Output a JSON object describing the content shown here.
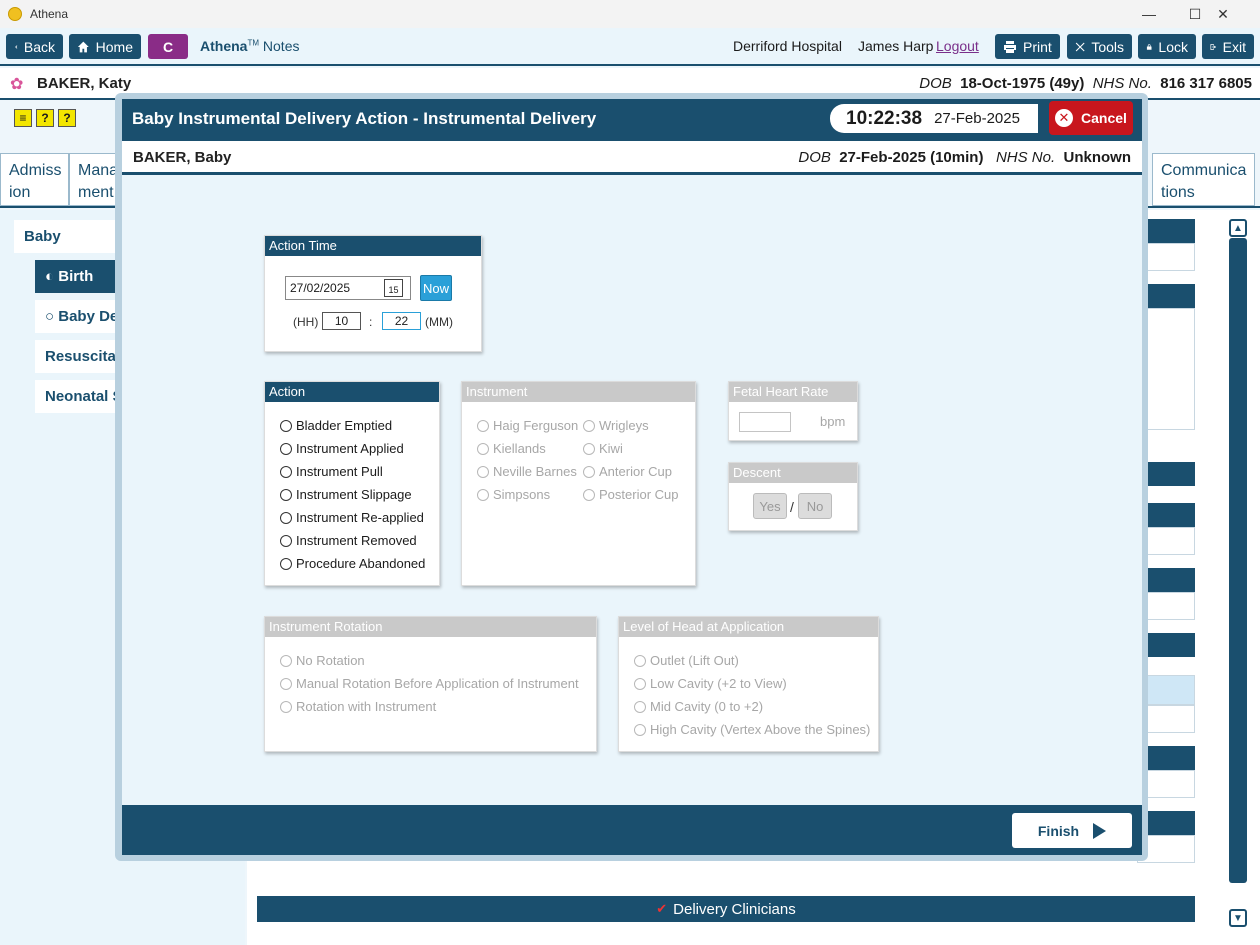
{
  "window": {
    "title": "Athena",
    "minimize": "—",
    "maximize": "☐",
    "close": "✕"
  },
  "toolbar": {
    "back": "Back",
    "home": "Home",
    "c": "C",
    "brand_name": "Athena",
    "brand_tm": "TM",
    "brand_suffix": "Notes",
    "hospital": "Derriford Hospital",
    "user": "James Harp",
    "logout": "Logout",
    "print": "Print",
    "tools": "Tools",
    "lock": "Lock",
    "exit": "Exit"
  },
  "patient": {
    "name": "BAKER, Katy",
    "dob_label": "DOB",
    "dob": "18-Oct-1975 (49y)",
    "nhs_label": "NHS No.",
    "nhs": "816 317 6805"
  },
  "underlay": {
    "tabs": [
      {
        "label": "Admiss ion"
      },
      {
        "label": "Mana ment"
      },
      {
        "label": "Communica tions"
      }
    ],
    "nav": [
      {
        "label": "Baby"
      },
      {
        "label": "Birth"
      },
      {
        "label": "Baby Det"
      },
      {
        "label": "Resuscitati"
      },
      {
        "label": "Neonatal S"
      }
    ],
    "delivery_clinicians": "Delivery Clinicians"
  },
  "dialog": {
    "title": "Baby Instrumental Delivery Action - Instrumental Delivery",
    "clock_time": "10:22:38",
    "clock_date": "27-Feb-2025",
    "cancel": "Cancel",
    "baby_name": "BAKER, Baby",
    "dob_label": "DOB",
    "dob": "27-Feb-2025 (10min)",
    "nhs_label": "NHS No.",
    "nhs": "Unknown",
    "finish": "Finish"
  },
  "action_time": {
    "header": "Action Time",
    "date": "27/02/2025",
    "cal_day": "15",
    "now": "Now",
    "hh_label": "(HH)",
    "hh": "10",
    "sep": ":",
    "mm": "22",
    "mm_label": "(MM)"
  },
  "action": {
    "header": "Action",
    "options": [
      "Bladder Emptied",
      "Instrument Applied",
      "Instrument Pull",
      "Instrument Slippage",
      "Instrument Re-applied",
      "Instrument Removed",
      "Procedure Abandoned"
    ]
  },
  "instrument": {
    "header": "Instrument",
    "col1": [
      "Haig Ferguson",
      "Kiellands",
      "Neville Barnes",
      "Simpsons"
    ],
    "col2": [
      "Wrigleys",
      "Kiwi",
      "Anterior Cup",
      "Posterior Cup"
    ]
  },
  "fetal_heart_rate": {
    "header": "Fetal Heart Rate",
    "unit": "bpm"
  },
  "descent": {
    "header": "Descent",
    "yes": "Yes",
    "sep": "/",
    "no": "No"
  },
  "rotation": {
    "header": "Instrument Rotation",
    "options": [
      "No Rotation",
      "Manual Rotation Before Application of Instrument",
      "Rotation with Instrument"
    ]
  },
  "level_of_head": {
    "header": "Level of Head at Application",
    "options": [
      "Outlet (Lift Out)",
      "Low Cavity (+2 to View)",
      "Mid Cavity (0 to +2)",
      "High Cavity (Vertex Above the Spines)"
    ]
  }
}
